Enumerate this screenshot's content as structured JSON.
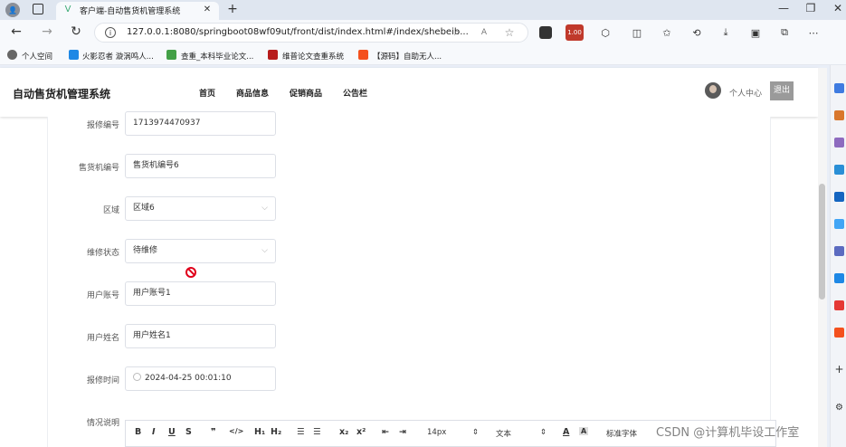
{
  "browser": {
    "tab_title": "客户端-自动售货机管理系统",
    "url": "127.0.0.1:8080/springboot08wf09ut/front/dist/index.html#/index/shebeib...",
    "badge": "1.00",
    "bookmarks": [
      "个人空间",
      "火影忍者 漩涡鸣人...",
      "查重_本科毕业论文...",
      "维普论文查重系统",
      "【源码】自助无人..."
    ]
  },
  "header": {
    "logo": "自动售货机管理系统",
    "nav": [
      "首页",
      "商品信息",
      "促销商品",
      "公告栏"
    ],
    "user_center": "个人中心",
    "logout": "退出"
  },
  "form": {
    "fields": [
      {
        "label": "报修编号",
        "value": "1713974470937"
      },
      {
        "label": "售货机编号",
        "value": "售货机编号6"
      },
      {
        "label": "区域",
        "value": "区域6"
      },
      {
        "label": "维修状态",
        "value": "待维修"
      },
      {
        "label": "用户账号",
        "value": "用户账号1"
      },
      {
        "label": "用户姓名",
        "value": "用户姓名1"
      },
      {
        "label": "报修时间",
        "value": "2024-04-25 00:01:10"
      },
      {
        "label": "情况说明",
        "value": ""
      }
    ]
  },
  "editor": {
    "font_size": "14px",
    "text_style": "文本",
    "font_family": "标准字体"
  },
  "watermark": "CSDN @计算机毕设工作室"
}
